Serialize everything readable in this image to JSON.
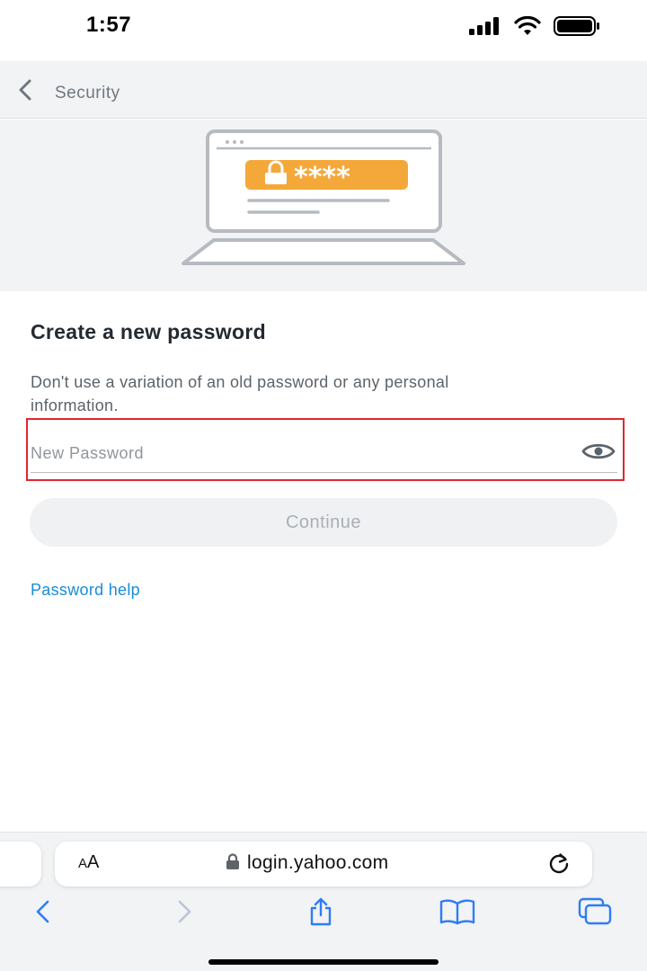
{
  "status_bar": {
    "time": "1:57"
  },
  "nav": {
    "title": "Security"
  },
  "hero": {
    "password_mask": "****"
  },
  "form": {
    "heading": "Create a new password",
    "description": "Don't use a variation of an old password or any personal information.",
    "password_placeholder": "New Password",
    "password_value": "",
    "continue_label": "Continue",
    "help_link": "Password help"
  },
  "browser": {
    "text_size_label_small": "A",
    "text_size_label_large": "A",
    "url": "login.yahoo.com"
  },
  "colors": {
    "accent_orange": "#f5a83a",
    "link_blue": "#1a8cd8",
    "highlight_red": "#e0272f",
    "ios_blue": "#2f7cf6"
  },
  "icons": [
    "back-chevron-icon",
    "lock-icon",
    "eye-icon",
    "reload-icon",
    "share-icon",
    "bookmarks-icon",
    "tabs-icon",
    "signal-icon",
    "wifi-icon",
    "battery-icon"
  ]
}
